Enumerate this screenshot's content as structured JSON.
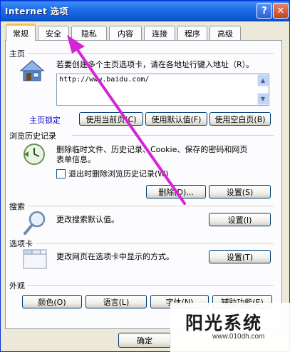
{
  "window": {
    "title": "Internet 选项",
    "help_glyph": "?",
    "close_glyph": "✕"
  },
  "tabs": [
    {
      "label": "常规"
    },
    {
      "label": "安全"
    },
    {
      "label": "隐私"
    },
    {
      "label": "内容"
    },
    {
      "label": "连接"
    },
    {
      "label": "程序"
    },
    {
      "label": "高级"
    }
  ],
  "homepage": {
    "group": "主页",
    "instruction": "若要创建多个主页选项卡，请在各地址行键入地址（R）。",
    "address": "http://www.baidu.com/",
    "link": "主页锁定",
    "btn_current": "使用当前页(C)",
    "btn_default": "使用默认值(F)",
    "btn_blank": "使用空白页(B)"
  },
  "history": {
    "group": "浏览历史记录",
    "desc_line1": "删除临时文件、历史记录、Cookie、保存的密码和网页",
    "desc_line2": "表单信息。",
    "checkbox_label": "退出时删除浏览历史记录(W)",
    "btn_delete": "删除(D)...",
    "btn_settings": "设置(S)"
  },
  "search": {
    "group": "搜索",
    "desc": "更改搜索默认值。",
    "btn_settings": "设置(I)"
  },
  "tabs_section": {
    "group": "选项卡",
    "desc": "更改网页在选项卡中显示的方式。",
    "btn_settings": "设置(T)"
  },
  "appearance": {
    "group": "外观",
    "btn_colors": "颜色(O)",
    "btn_languages": "语言(L)",
    "btn_fonts": "字体(N)",
    "btn_accessibility": "辅助功能(E)"
  },
  "footer": {
    "btn_ok": "确定"
  },
  "watermark": {
    "brand": "阳光系统",
    "url": "www.010dh.com"
  }
}
